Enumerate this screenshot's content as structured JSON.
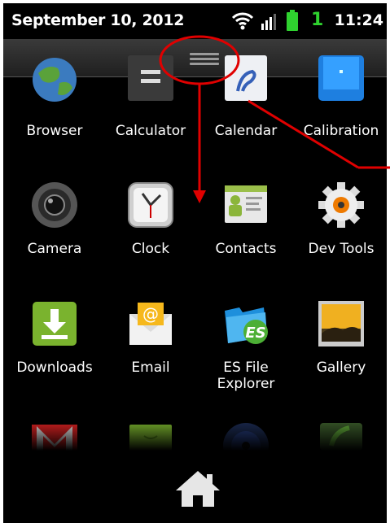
{
  "status_bar": {
    "date": "September 10, 2012",
    "notification_count": "1",
    "time": "11:24",
    "icons": [
      "wifi-icon",
      "signal-icon",
      "battery-icon"
    ]
  },
  "app_drawer": {
    "apps": [
      {
        "label": "Browser",
        "icon": "globe-icon"
      },
      {
        "label": "Calculator",
        "icon": "calculator-icon"
      },
      {
        "label": "Calendar",
        "icon": "calendar-icon"
      },
      {
        "label": "Calibration",
        "icon": "calibration-icon"
      },
      {
        "label": "Camera",
        "icon": "camera-lens-icon"
      },
      {
        "label": "Clock",
        "icon": "clock-icon"
      },
      {
        "label": "Contacts",
        "icon": "contacts-icon"
      },
      {
        "label": "Dev Tools",
        "icon": "gear-icon"
      },
      {
        "label": "Downloads",
        "icon": "download-icon"
      },
      {
        "label": "Email",
        "icon": "envelope-icon"
      },
      {
        "label": "ES File Explorer",
        "label_lines": [
          "ES File",
          "Explorer"
        ],
        "icon": "folder-icon"
      },
      {
        "label": "Gallery",
        "icon": "picture-icon"
      }
    ],
    "partial_row_icons": [
      "gmail-icon",
      "market-icon",
      "music-icon",
      "phone-icon"
    ]
  },
  "dock": {
    "icon": "home-icon"
  },
  "colors": {
    "annotation": "#e00000",
    "status_notification": "#2fd22f",
    "handle_bar": "#2a2a2a"
  }
}
